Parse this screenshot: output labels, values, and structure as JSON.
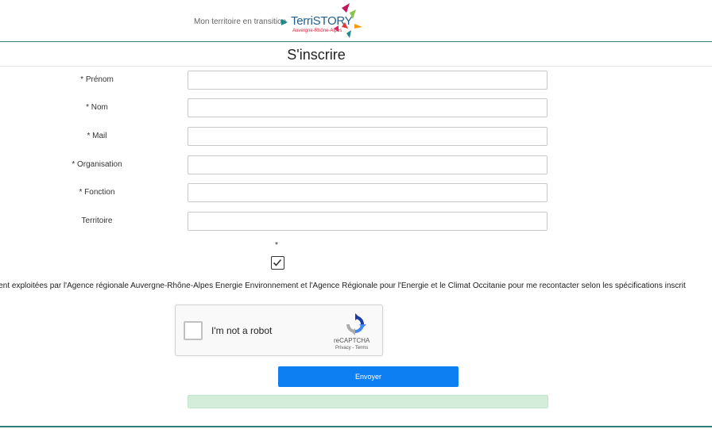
{
  "header": {
    "tagline": "Mon territoire en transition",
    "brand": "TerriSTORY",
    "brand_sub": "Auvergne-Rhône-Alpes"
  },
  "form": {
    "title": "S'inscrire",
    "fields": [
      {
        "label": "* Prénom",
        "value": ""
      },
      {
        "label": "* Nom",
        "value": ""
      },
      {
        "label": "* Mail",
        "value": ""
      },
      {
        "label": "* Organisation",
        "value": ""
      },
      {
        "label": "* Fonction",
        "value": ""
      },
      {
        "label": "Territoire",
        "value": ""
      }
    ],
    "consent_star": "*",
    "consent_checked": true,
    "consent_text": "ient exploitées par l'Agence régionale Auvergne-Rhône-Alpes Énergie Environnement et l'Agence Régionale pour l'Énergie et le Climat Occitanie pour me recontacter selon les spécifications inscrit",
    "submit_label": "Envoyer",
    "status_message": ""
  },
  "recaptcha": {
    "label": "I'm not a robot",
    "brand": "reCAPTCHA",
    "links": "Privacy - Terms",
    "checked": false
  },
  "colors": {
    "accent": "#0d7ff2",
    "header_line": "#2e7d7a",
    "status_bg": "#d4edda"
  }
}
